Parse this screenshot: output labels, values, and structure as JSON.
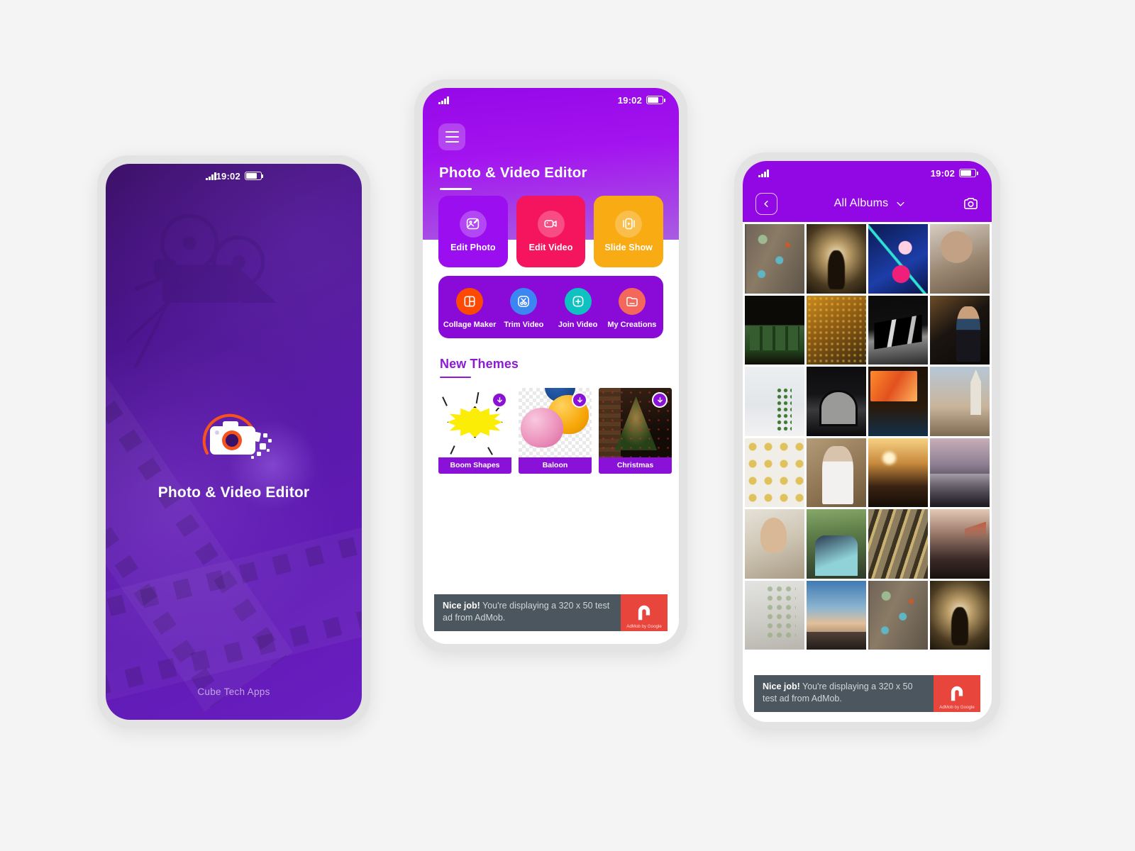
{
  "meta": {
    "app_name": "Photo & Video Editor",
    "vendor": "Cube Tech Apps",
    "status_time": "19:02",
    "colors": {
      "brand_purple": "#9208e4",
      "deep_purple": "#8a0ad8",
      "splash_purple": "#5b19ad",
      "pink": "#f5155e",
      "orange": "#f9ab13",
      "accent_orange": "#fc4a05",
      "blue": "#3b86f0",
      "teal": "#0dc2c0",
      "salmon": "#f4685c",
      "admob_red": "#e8453c",
      "admob_grey": "#4c565e"
    }
  },
  "splash": {
    "title": "Photo & Video Editor",
    "footer": "Cube Tech Apps",
    "logo_name": "camera-logo"
  },
  "home": {
    "menu_label": "Menu",
    "title": "Photo & Video Editor",
    "cards": [
      {
        "label": "Edit Photo",
        "icon": "edit-photo-icon",
        "color": "#9b0ef0"
      },
      {
        "label": "Edit Video",
        "icon": "edit-video-icon",
        "color": "#f5155e"
      },
      {
        "label": "Slide Show",
        "icon": "slide-show-icon",
        "color": "#f9ab13"
      }
    ],
    "tools": [
      {
        "label": "Collage Maker",
        "icon": "collage-icon",
        "color": "#fc4a05"
      },
      {
        "label": "Trim Video",
        "icon": "scissors-icon",
        "color": "#3b86f0"
      },
      {
        "label": "Join Video",
        "icon": "plus-square-icon",
        "color": "#0dc2c0"
      },
      {
        "label": "My Creations",
        "icon": "folder-icon",
        "color": "#f4685c"
      }
    ],
    "themes_section_title": "New Themes",
    "themes": [
      {
        "label": "Boom Shapes",
        "art": "boom",
        "download": "download-icon"
      },
      {
        "label": "Baloon",
        "art": "balloon",
        "download": "download-icon"
      },
      {
        "label": "Christmas",
        "art": "xmas",
        "download": "download-icon"
      },
      {
        "label": "",
        "art": "white",
        "download": "download-icon"
      }
    ]
  },
  "albums": {
    "back_label": "Back",
    "title": "All Albums",
    "dropdown_icon": "chevron-down-icon",
    "camera_icon": "camera-icon",
    "photos": [
      "aerial",
      "hand",
      "flower",
      "mother",
      "tunnel",
      "forest",
      "abstract",
      "man",
      "plant",
      "arch",
      "desk",
      "church",
      "coins",
      "tattoo",
      "sunset",
      "coast",
      "woman",
      "family",
      "stripes",
      "bridge",
      "wall",
      "city",
      "aerial",
      "hand"
    ]
  },
  "ad": {
    "headline": "Nice job!",
    "body": " You're displaying a 320 x 50 test ad from AdMob.",
    "caption": "AdMob by Google"
  }
}
